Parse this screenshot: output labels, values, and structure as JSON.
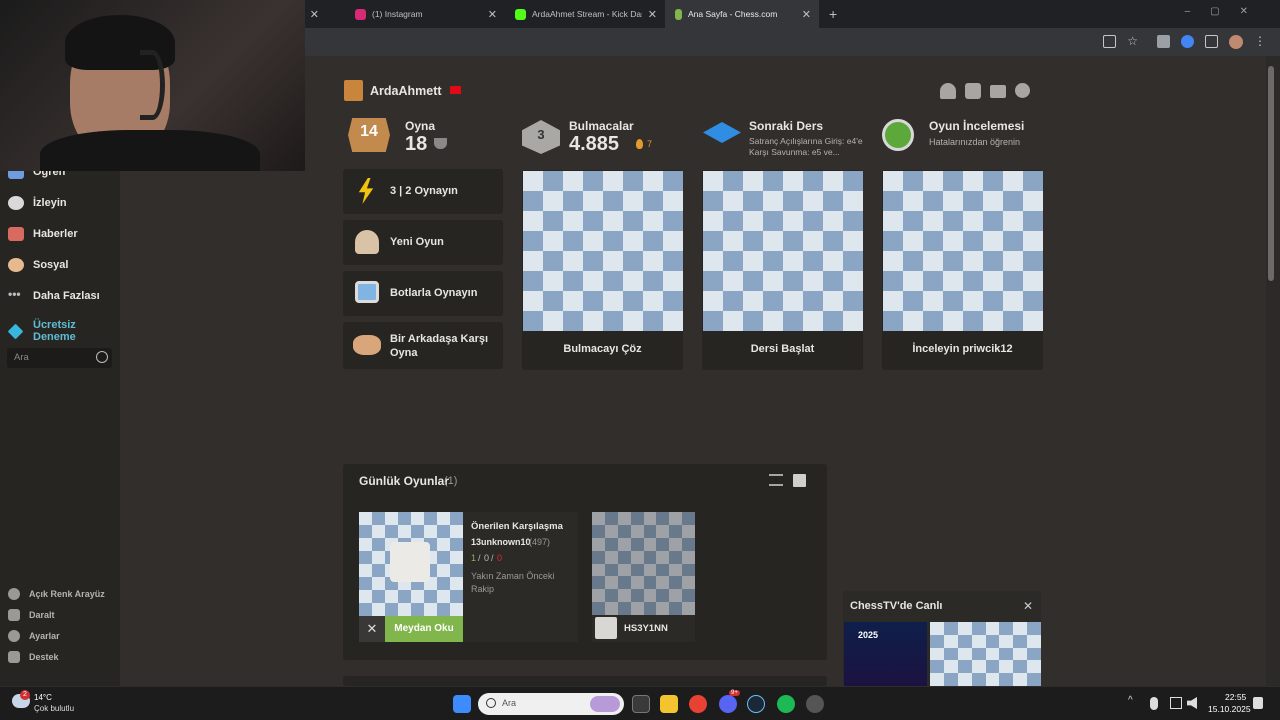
{
  "browser": {
    "tabs": [
      {
        "label": "(1) Instagram",
        "color": "#d62976"
      },
      {
        "label": "ArdaAhmet Stream - Kick Dashb",
        "color": "#53fc18"
      },
      {
        "label": "Ana Sayfa - Chess.com",
        "color": "#81b64c"
      }
    ],
    "new_tab": "+"
  },
  "sidebar": {
    "items": [
      {
        "label": "Öğren"
      },
      {
        "label": "İzleyin"
      },
      {
        "label": "Haberler"
      },
      {
        "label": "Sosyal"
      },
      {
        "label": "Daha Fazlası"
      },
      {
        "label": "Ücretsiz Deneme"
      }
    ],
    "search_placeholder": "Ara",
    "bottom": [
      {
        "label": "Açık Renk Arayüz"
      },
      {
        "label": "Daralt"
      },
      {
        "label": "Ayarlar"
      },
      {
        "label": "Destek"
      }
    ]
  },
  "profile": {
    "username": "ArdaAhmett",
    "flag": "TR"
  },
  "stats": {
    "play": {
      "title": "Oyna",
      "value": "18",
      "badge": "14"
    },
    "puzzles": {
      "title": "Bulmacalar",
      "value": "4.885",
      "streak": "7",
      "badge": "3"
    },
    "lesson": {
      "title": "Sonraki Ders",
      "desc": "Satranç Açılışlarına Giriş: e4'e Karşı Savunma: e5 ve..."
    },
    "review": {
      "title": "Oyun İncelemesi",
      "desc": "Hatalarınızdan öğrenin"
    }
  },
  "play_buttons": [
    {
      "label": "3 | 2 Oynayın"
    },
    {
      "label": "Yeni Oyun"
    },
    {
      "label": "Botlarla Oynayın"
    },
    {
      "label": "Bir Arkadaşa Karşı Oyna"
    }
  ],
  "board_cards": [
    {
      "label": "Bulmacayı Çöz"
    },
    {
      "label": "Dersi Başlat"
    },
    {
      "label": "İnceleyin priwcik12"
    }
  ],
  "daily": {
    "title": "Günlük Oyunlar",
    "count": "(1)",
    "suggested": {
      "title": "Önerilen Karşılaşma",
      "opponent": "13unknown10",
      "rating": "(497)",
      "record_w": "1",
      "record_d": "0",
      "record_l": "0",
      "note": "Yakın Zaman Önceki Rakip",
      "challenge": "Meydan Oku"
    },
    "game_player": "HS3Y1NN"
  },
  "chesstv": {
    "title": "ChessTV'de Canlı",
    "badge": "2025"
  },
  "taskbar": {
    "weather_temp": "14°C",
    "weather_desc": "Çok bulutlu",
    "weather_badge": "2",
    "search_placeholder": "Ara",
    "time": "22:55",
    "date": "15.10.2025",
    "discord_badge": "9+"
  }
}
